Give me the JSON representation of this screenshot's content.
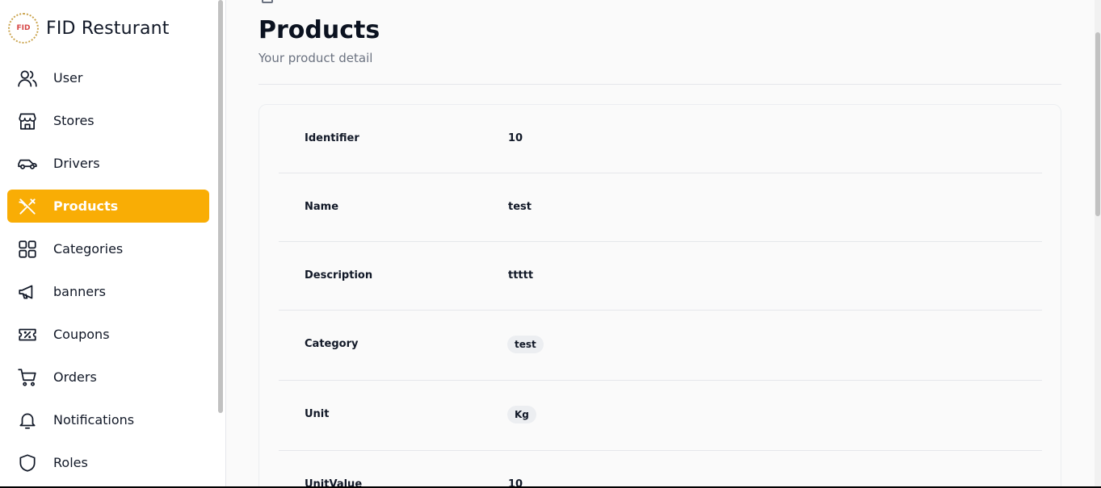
{
  "brand": {
    "logo_text": "FID",
    "title": "FID Resturant"
  },
  "sidebar": {
    "items": [
      {
        "label": "User",
        "icon": "users-icon",
        "active": false
      },
      {
        "label": "Stores",
        "icon": "store-icon",
        "active": false
      },
      {
        "label": "Drivers",
        "icon": "car-icon",
        "active": false
      },
      {
        "label": "Products",
        "icon": "utensils-icon",
        "active": true
      },
      {
        "label": "Categories",
        "icon": "grid-icon",
        "active": false
      },
      {
        "label": "banners",
        "icon": "megaphone-icon",
        "active": false
      },
      {
        "label": "Coupons",
        "icon": "ticket-icon",
        "active": false
      },
      {
        "label": "Orders",
        "icon": "cart-icon",
        "active": false
      },
      {
        "label": "Notifications",
        "icon": "bell-icon",
        "active": false
      },
      {
        "label": "Roles",
        "icon": "shield-icon",
        "active": false
      }
    ]
  },
  "page": {
    "title": "Products",
    "subtitle": "Your product detail"
  },
  "details": [
    {
      "label": "Identifier",
      "value": "10",
      "type": "text"
    },
    {
      "label": "Name",
      "value": "test",
      "type": "text"
    },
    {
      "label": "Description",
      "value": "ttttt",
      "type": "text"
    },
    {
      "label": "Category",
      "value": "test",
      "type": "pill"
    },
    {
      "label": "Unit",
      "value": "Kg",
      "type": "pill"
    },
    {
      "label": "UnitValue",
      "value": "10",
      "type": "text"
    }
  ],
  "colors": {
    "accent": "#f9ad05",
    "text": "#111827",
    "muted": "#6b7280"
  }
}
